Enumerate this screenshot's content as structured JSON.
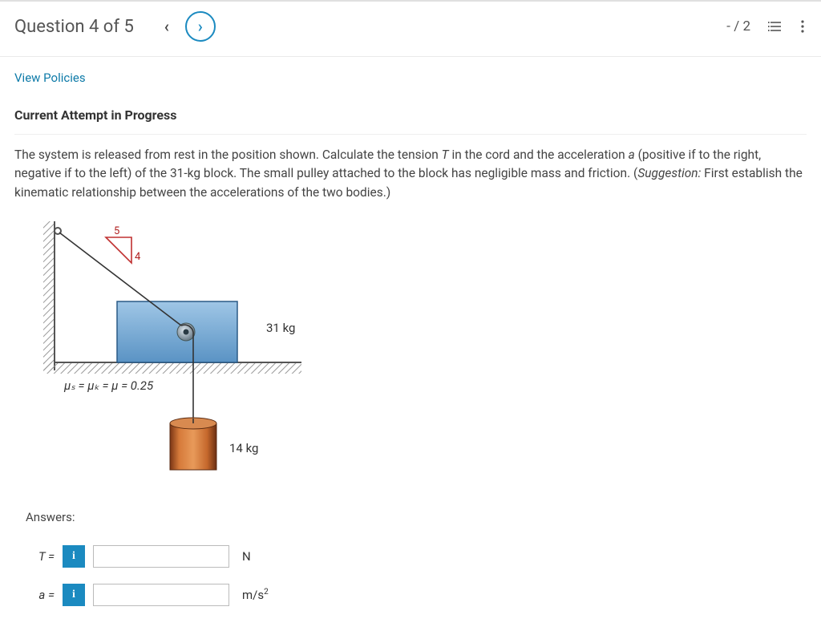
{
  "header": {
    "title": "Question 4 of 5",
    "prev_icon": "‹",
    "next_icon": "›",
    "score": "- / 2"
  },
  "links": {
    "view_policies": "View Policies"
  },
  "status": {
    "attempt": "Current Attempt in Progress"
  },
  "problem": {
    "text_1": "The system is released from rest in the position shown. Calculate the tension ",
    "T": "T",
    "text_2": " in the cord and the acceleration ",
    "a": "a",
    "text_3": " (positive if to the right, negative if to the left) of the 31-kg block. The small pulley attached to the block has negligible mass and friction. (",
    "sugg_label": "Suggestion:",
    "text_4": " First establish the kinematic relationship between the accelerations of the two bodies.)"
  },
  "diagram": {
    "slope_rise": "5",
    "slope_run": "4",
    "block_mass": "31 kg",
    "hanging_mass": "14 kg",
    "mu_equation": "μₛ = μₖ = μ = 0.25"
  },
  "answers": {
    "label": "Answers:",
    "rows": [
      {
        "var": "T",
        "eq": "=",
        "unit": "N"
      },
      {
        "var": "a",
        "eq": "=",
        "unit_html": "m/s²"
      }
    ],
    "info_glyph": "i",
    "unit_T": "N",
    "unit_a_prefix": "m/s",
    "unit_a_exp": "2"
  }
}
